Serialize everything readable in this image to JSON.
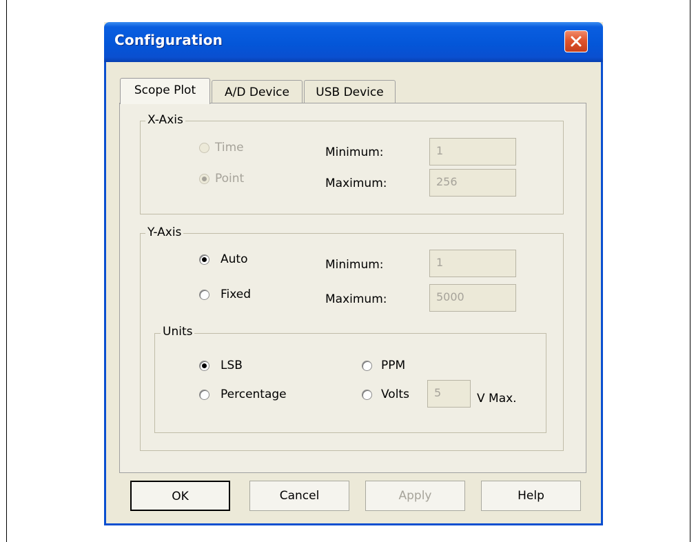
{
  "dialog": {
    "title": "Configuration"
  },
  "tabs": [
    {
      "label": "Scope Plot",
      "active": true
    },
    {
      "label": "A/D Device",
      "active": false
    },
    {
      "label": "USB Device",
      "active": false
    }
  ],
  "x_axis": {
    "legend": "X-Axis",
    "options": [
      {
        "label": "Time",
        "checked": false,
        "enabled": false
      },
      {
        "label": "Point",
        "checked": true,
        "enabled": false
      }
    ],
    "min_label": "Minimum:",
    "min_value": "1",
    "max_label": "Maximum:",
    "max_value": "256"
  },
  "y_axis": {
    "legend": "Y-Axis",
    "options": [
      {
        "label": "Auto",
        "checked": true,
        "enabled": true
      },
      {
        "label": "Fixed",
        "checked": false,
        "enabled": true
      }
    ],
    "min_label": "Minimum:",
    "min_value": "1",
    "max_label": "Maximum:",
    "max_value": "5000",
    "units": {
      "legend": "Units",
      "options": [
        {
          "label": "LSB",
          "checked": true
        },
        {
          "label": "Percentage",
          "checked": false
        },
        {
          "label": "PPM",
          "checked": false
        },
        {
          "label": "Volts",
          "checked": false
        }
      ],
      "volts_value": "5",
      "volts_suffix": "V Max."
    }
  },
  "buttons": {
    "ok": "OK",
    "cancel": "Cancel",
    "apply": "Apply",
    "help": "Help"
  }
}
